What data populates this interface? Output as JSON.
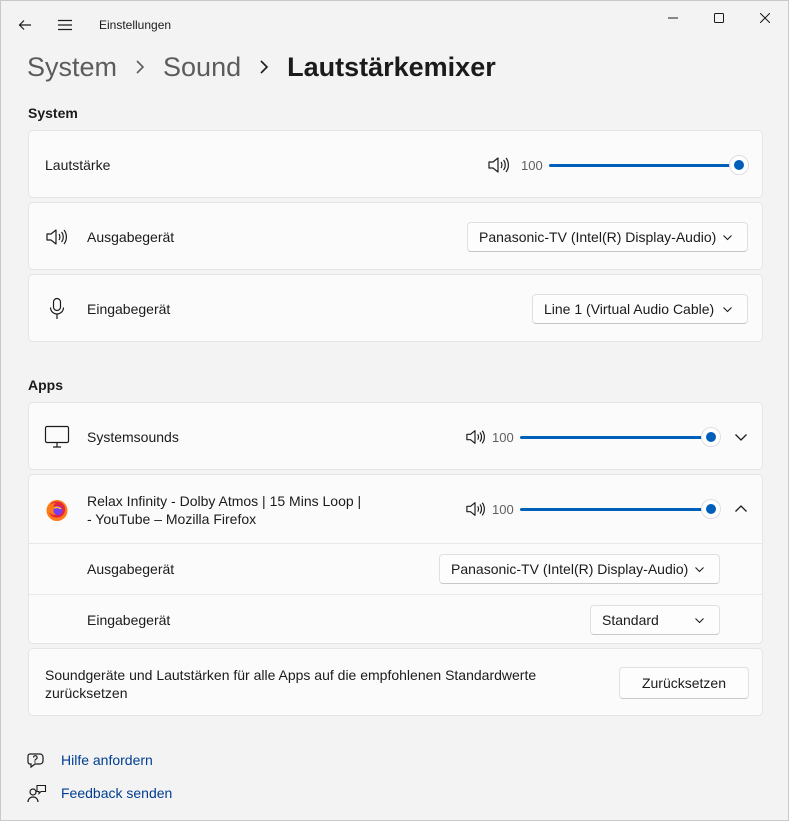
{
  "window": {
    "title": "Einstellungen"
  },
  "breadcrumb": {
    "items": [
      "System",
      "Sound"
    ],
    "current": "Lautstärkemixer"
  },
  "system_section": {
    "label": "System",
    "volume": {
      "label": "Lautstärke",
      "value": "100",
      "level": 1.0
    },
    "output": {
      "label": "Ausgabegerät",
      "selected": "Panasonic-TV (Intel(R) Display-Audio)"
    },
    "input": {
      "label": "Eingabegerät",
      "selected": "Line 1 (Virtual Audio Cable)"
    }
  },
  "apps_section": {
    "label": "Apps",
    "systemsounds": {
      "label": "Systemsounds",
      "value": "100",
      "level": 1.0
    },
    "firefox": {
      "line1": "Relax Infinity - Dolby Atmos | 15 Mins Loop |",
      "line2": "- YouTube – Mozilla Firefox",
      "value": "100",
      "level": 1.0,
      "output_label": "Ausgabegerät",
      "output_selected": "Panasonic-TV (Intel(R) Display-Audio)",
      "input_label": "Eingabegerät",
      "input_selected": "Standard"
    }
  },
  "reset": {
    "text_line1": "Soundgeräte und Lautstärken für alle Apps auf die empfohlenen Standardwerte",
    "text_line2": "zurücksetzen",
    "button_label": "Zurücksetzen"
  },
  "footer": {
    "help": "Hilfe anfordern",
    "feedback": "Feedback senden"
  },
  "colors": {
    "accent": "#005fb8",
    "link": "#003e92"
  }
}
